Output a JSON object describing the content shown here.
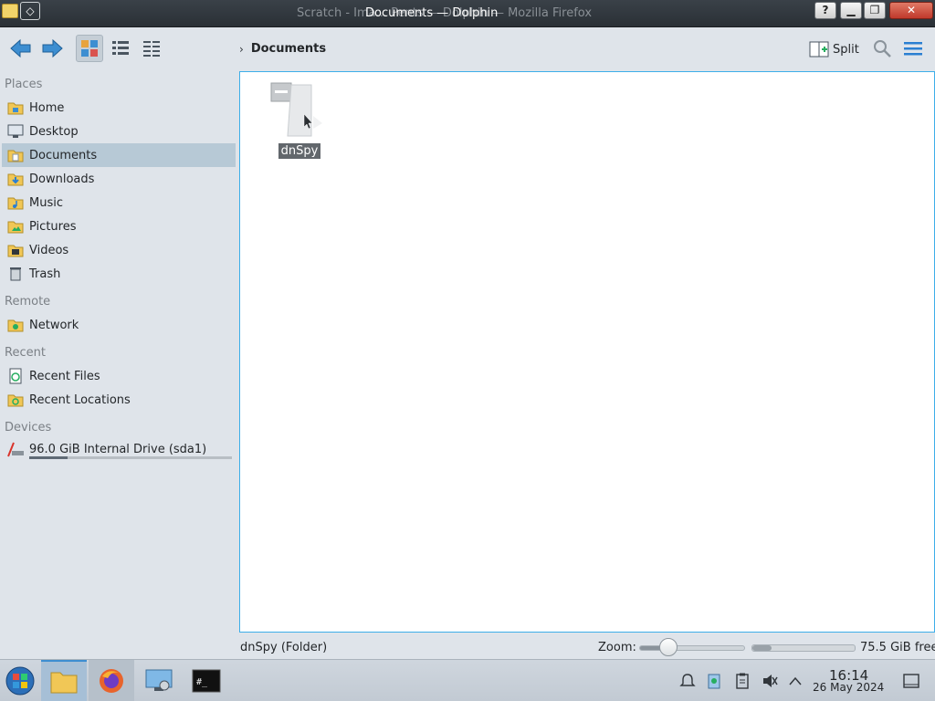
{
  "window": {
    "title": "Documents — Dolphin",
    "background_title": "Scratch - Ima... Pents — Dolphin — Mozilla Firefox",
    "menu_glyph": "◇",
    "buttons": {
      "help": "?",
      "minimize": "▁",
      "maximize": "❐",
      "close": "✕"
    }
  },
  "toolbar": {
    "breadcrumb_chevron": "›",
    "breadcrumb": "Documents",
    "split_label": "Split"
  },
  "sidebar": {
    "places_title": "Places",
    "places": [
      {
        "label": "Home",
        "icon": "home-folder-icon"
      },
      {
        "label": "Desktop",
        "icon": "desktop-icon"
      },
      {
        "label": "Documents",
        "icon": "documents-folder-icon",
        "selected": true
      },
      {
        "label": "Downloads",
        "icon": "downloads-folder-icon"
      },
      {
        "label": "Music",
        "icon": "music-folder-icon"
      },
      {
        "label": "Pictures",
        "icon": "pictures-folder-icon"
      },
      {
        "label": "Videos",
        "icon": "videos-folder-icon"
      },
      {
        "label": "Trash",
        "icon": "trash-icon"
      }
    ],
    "remote_title": "Remote",
    "remote": [
      {
        "label": "Network",
        "icon": "network-folder-icon"
      }
    ],
    "recent_title": "Recent",
    "recent": [
      {
        "label": "Recent Files",
        "icon": "recent-files-icon"
      },
      {
        "label": "Recent Locations",
        "icon": "recent-locations-icon"
      }
    ],
    "devices_title": "Devices",
    "devices": [
      {
        "label": "96.0 GiB Internal Drive (sda1)",
        "icon": "drive-icon",
        "usage_fraction": 0.19
      }
    ]
  },
  "content": {
    "items": [
      {
        "name": "dnSpy",
        "type": "folder",
        "selected": true
      }
    ]
  },
  "statusbar": {
    "status_text": "dnSpy (Folder)",
    "zoom_label": "Zoom:",
    "zoom_fraction": 0.28,
    "free_space_fraction": 0.19,
    "free_space_text": "75.5 GiB free"
  },
  "taskbar": {
    "time": "16:14",
    "date": "26 May 2024",
    "terminal_glyph": "#_"
  },
  "colors": {
    "accent": "#3daee9",
    "selection": "#b7c9d6",
    "window_bg": "#dfe4ea"
  }
}
